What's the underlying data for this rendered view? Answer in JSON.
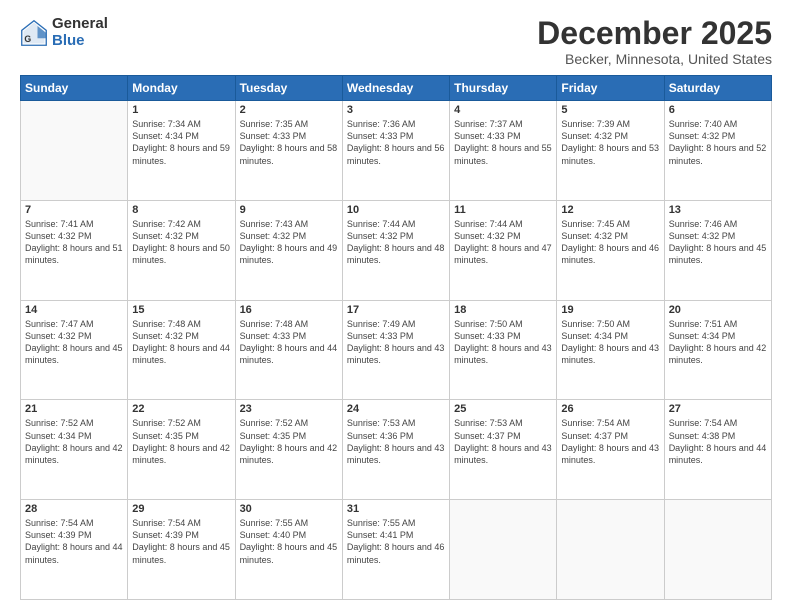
{
  "logo": {
    "general": "General",
    "blue": "Blue"
  },
  "header": {
    "month": "December 2025",
    "location": "Becker, Minnesota, United States"
  },
  "weekdays": [
    "Sunday",
    "Monday",
    "Tuesday",
    "Wednesday",
    "Thursday",
    "Friday",
    "Saturday"
  ],
  "weeks": [
    [
      {
        "day": "",
        "sunrise": "",
        "sunset": "",
        "daylight": ""
      },
      {
        "day": "1",
        "sunrise": "Sunrise: 7:34 AM",
        "sunset": "Sunset: 4:34 PM",
        "daylight": "Daylight: 8 hours and 59 minutes."
      },
      {
        "day": "2",
        "sunrise": "Sunrise: 7:35 AM",
        "sunset": "Sunset: 4:33 PM",
        "daylight": "Daylight: 8 hours and 58 minutes."
      },
      {
        "day": "3",
        "sunrise": "Sunrise: 7:36 AM",
        "sunset": "Sunset: 4:33 PM",
        "daylight": "Daylight: 8 hours and 56 minutes."
      },
      {
        "day": "4",
        "sunrise": "Sunrise: 7:37 AM",
        "sunset": "Sunset: 4:33 PM",
        "daylight": "Daylight: 8 hours and 55 minutes."
      },
      {
        "day": "5",
        "sunrise": "Sunrise: 7:39 AM",
        "sunset": "Sunset: 4:32 PM",
        "daylight": "Daylight: 8 hours and 53 minutes."
      },
      {
        "day": "6",
        "sunrise": "Sunrise: 7:40 AM",
        "sunset": "Sunset: 4:32 PM",
        "daylight": "Daylight: 8 hours and 52 minutes."
      }
    ],
    [
      {
        "day": "7",
        "sunrise": "Sunrise: 7:41 AM",
        "sunset": "Sunset: 4:32 PM",
        "daylight": "Daylight: 8 hours and 51 minutes."
      },
      {
        "day": "8",
        "sunrise": "Sunrise: 7:42 AM",
        "sunset": "Sunset: 4:32 PM",
        "daylight": "Daylight: 8 hours and 50 minutes."
      },
      {
        "day": "9",
        "sunrise": "Sunrise: 7:43 AM",
        "sunset": "Sunset: 4:32 PM",
        "daylight": "Daylight: 8 hours and 49 minutes."
      },
      {
        "day": "10",
        "sunrise": "Sunrise: 7:44 AM",
        "sunset": "Sunset: 4:32 PM",
        "daylight": "Daylight: 8 hours and 48 minutes."
      },
      {
        "day": "11",
        "sunrise": "Sunrise: 7:44 AM",
        "sunset": "Sunset: 4:32 PM",
        "daylight": "Daylight: 8 hours and 47 minutes."
      },
      {
        "day": "12",
        "sunrise": "Sunrise: 7:45 AM",
        "sunset": "Sunset: 4:32 PM",
        "daylight": "Daylight: 8 hours and 46 minutes."
      },
      {
        "day": "13",
        "sunrise": "Sunrise: 7:46 AM",
        "sunset": "Sunset: 4:32 PM",
        "daylight": "Daylight: 8 hours and 45 minutes."
      }
    ],
    [
      {
        "day": "14",
        "sunrise": "Sunrise: 7:47 AM",
        "sunset": "Sunset: 4:32 PM",
        "daylight": "Daylight: 8 hours and 45 minutes."
      },
      {
        "day": "15",
        "sunrise": "Sunrise: 7:48 AM",
        "sunset": "Sunset: 4:32 PM",
        "daylight": "Daylight: 8 hours and 44 minutes."
      },
      {
        "day": "16",
        "sunrise": "Sunrise: 7:48 AM",
        "sunset": "Sunset: 4:33 PM",
        "daylight": "Daylight: 8 hours and 44 minutes."
      },
      {
        "day": "17",
        "sunrise": "Sunrise: 7:49 AM",
        "sunset": "Sunset: 4:33 PM",
        "daylight": "Daylight: 8 hours and 43 minutes."
      },
      {
        "day": "18",
        "sunrise": "Sunrise: 7:50 AM",
        "sunset": "Sunset: 4:33 PM",
        "daylight": "Daylight: 8 hours and 43 minutes."
      },
      {
        "day": "19",
        "sunrise": "Sunrise: 7:50 AM",
        "sunset": "Sunset: 4:34 PM",
        "daylight": "Daylight: 8 hours and 43 minutes."
      },
      {
        "day": "20",
        "sunrise": "Sunrise: 7:51 AM",
        "sunset": "Sunset: 4:34 PM",
        "daylight": "Daylight: 8 hours and 42 minutes."
      }
    ],
    [
      {
        "day": "21",
        "sunrise": "Sunrise: 7:52 AM",
        "sunset": "Sunset: 4:34 PM",
        "daylight": "Daylight: 8 hours and 42 minutes."
      },
      {
        "day": "22",
        "sunrise": "Sunrise: 7:52 AM",
        "sunset": "Sunset: 4:35 PM",
        "daylight": "Daylight: 8 hours and 42 minutes."
      },
      {
        "day": "23",
        "sunrise": "Sunrise: 7:52 AM",
        "sunset": "Sunset: 4:35 PM",
        "daylight": "Daylight: 8 hours and 42 minutes."
      },
      {
        "day": "24",
        "sunrise": "Sunrise: 7:53 AM",
        "sunset": "Sunset: 4:36 PM",
        "daylight": "Daylight: 8 hours and 43 minutes."
      },
      {
        "day": "25",
        "sunrise": "Sunrise: 7:53 AM",
        "sunset": "Sunset: 4:37 PM",
        "daylight": "Daylight: 8 hours and 43 minutes."
      },
      {
        "day": "26",
        "sunrise": "Sunrise: 7:54 AM",
        "sunset": "Sunset: 4:37 PM",
        "daylight": "Daylight: 8 hours and 43 minutes."
      },
      {
        "day": "27",
        "sunrise": "Sunrise: 7:54 AM",
        "sunset": "Sunset: 4:38 PM",
        "daylight": "Daylight: 8 hours and 44 minutes."
      }
    ],
    [
      {
        "day": "28",
        "sunrise": "Sunrise: 7:54 AM",
        "sunset": "Sunset: 4:39 PM",
        "daylight": "Daylight: 8 hours and 44 minutes."
      },
      {
        "day": "29",
        "sunrise": "Sunrise: 7:54 AM",
        "sunset": "Sunset: 4:39 PM",
        "daylight": "Daylight: 8 hours and 45 minutes."
      },
      {
        "day": "30",
        "sunrise": "Sunrise: 7:55 AM",
        "sunset": "Sunset: 4:40 PM",
        "daylight": "Daylight: 8 hours and 45 minutes."
      },
      {
        "day": "31",
        "sunrise": "Sunrise: 7:55 AM",
        "sunset": "Sunset: 4:41 PM",
        "daylight": "Daylight: 8 hours and 46 minutes."
      },
      {
        "day": "",
        "sunrise": "",
        "sunset": "",
        "daylight": ""
      },
      {
        "day": "",
        "sunrise": "",
        "sunset": "",
        "daylight": ""
      },
      {
        "day": "",
        "sunrise": "",
        "sunset": "",
        "daylight": ""
      }
    ]
  ]
}
